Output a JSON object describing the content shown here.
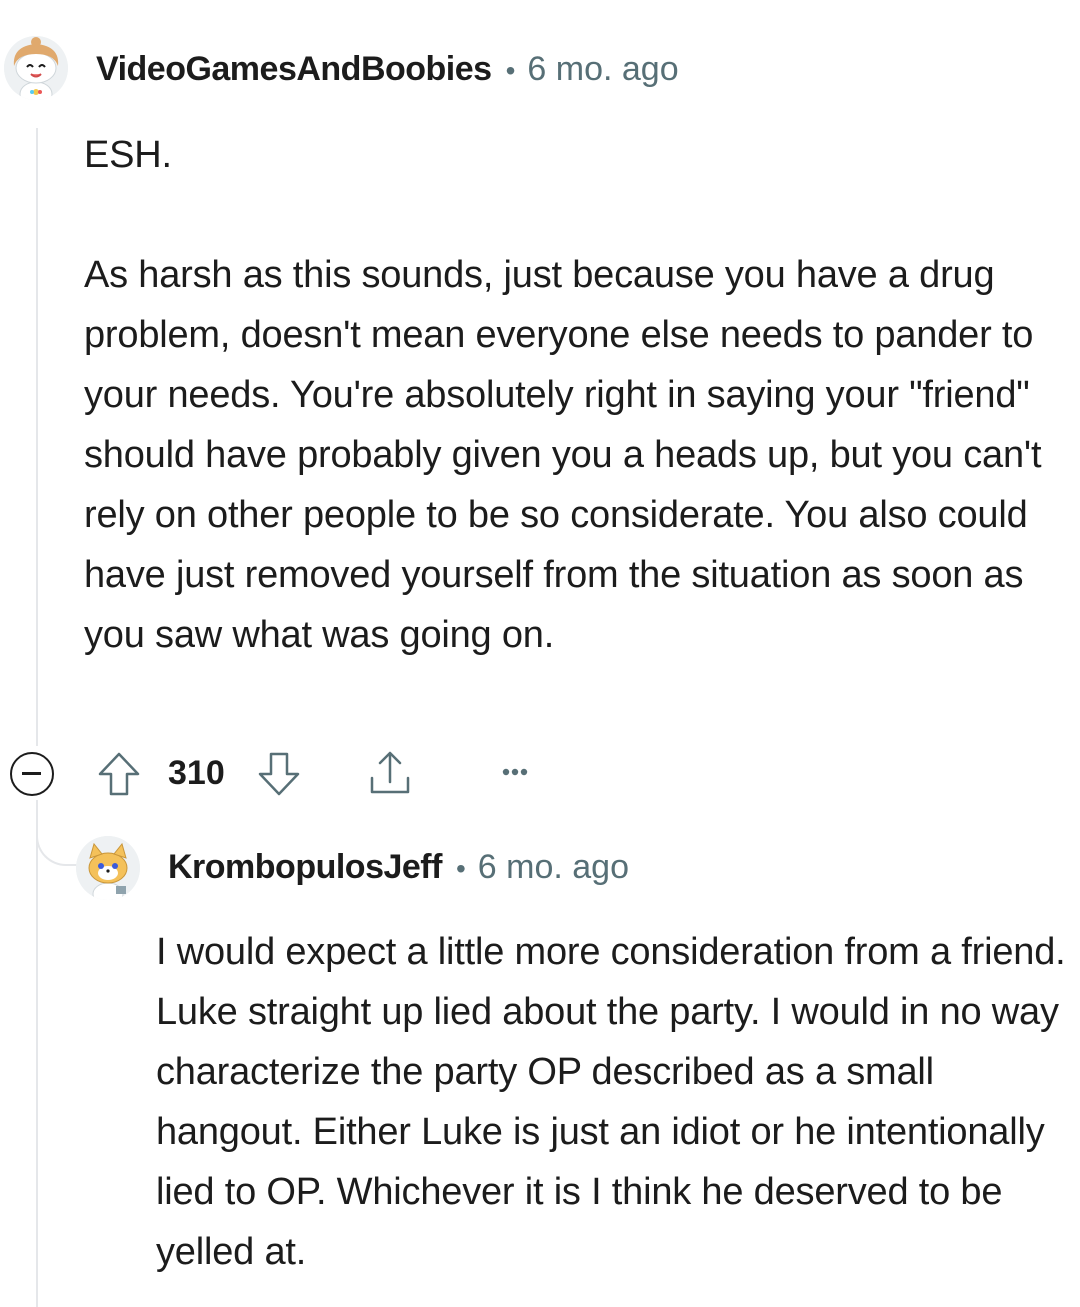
{
  "comments": [
    {
      "username": "VideoGamesAndBoobies",
      "separator": "•",
      "timestamp": "6 mo. ago",
      "paragraphs": [
        "ESH.",
        "As harsh as this sounds, just because you have a drug problem, doesn't mean everyone else needs to pander to your needs. You're absolutely right in saying your \"friend\" should have probably given you a heads up, but you can't rely on other people to be so considerate. You also could have just removed yourself from the situation as soon as you saw what was going on."
      ],
      "vote_count": "310"
    },
    {
      "username": "KrombopulosJeff",
      "separator": "•",
      "timestamp": "6 mo. ago",
      "paragraphs": [
        "I would expect a little more consideration from a friend. Luke straight up lied about the party. I would in no way characterize the party OP described as a small hangout. Either Luke is just an idiot or he intentionally lied to OP. Whichever it is I think he deserved to be yelled at."
      ]
    }
  ],
  "icons": {
    "collapse": "collapse-minus-icon",
    "upvote": "upvote-arrow-icon",
    "downvote": "downvote-arrow-icon",
    "share": "share-icon",
    "more": "more-options-icon"
  },
  "colors": {
    "text": "#1c1c1c",
    "meta": "#576f76",
    "thread_line": "#e5e7ea"
  }
}
